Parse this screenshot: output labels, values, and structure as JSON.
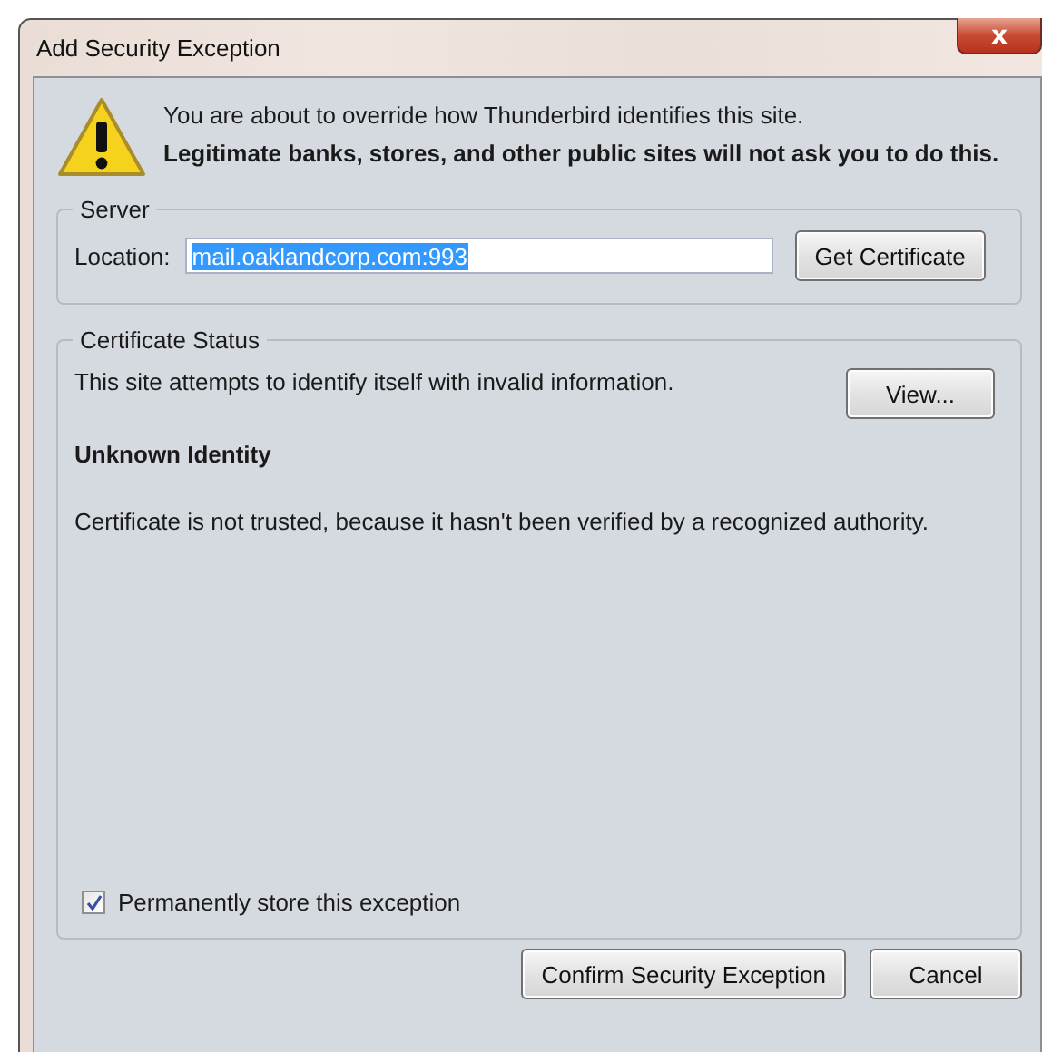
{
  "window": {
    "title": "Add Security Exception",
    "close_glyph": "x"
  },
  "warning": {
    "message": "You are about to override how Thunderbird identifies this site.",
    "emphasis": "Legitimate banks, stores, and other public sites will not ask you to do this."
  },
  "server": {
    "legend": "Server",
    "location_label": "Location:",
    "location_value": "mail.oaklandcorp.com:993",
    "value_selected": true,
    "button": "Get Certificate"
  },
  "certificate_status": {
    "legend": "Certificate Status",
    "summary": "This site attempts to identify itself with invalid information.",
    "view_button": "View...",
    "heading": "Unknown Identity",
    "detail": "Certificate is not trusted, because it hasn't been verified by a recognized authority."
  },
  "permanent": {
    "label": "Permanently store this exception",
    "checked": true
  },
  "buttons": [
    "Confirm Security Exception",
    "Cancel"
  ]
}
